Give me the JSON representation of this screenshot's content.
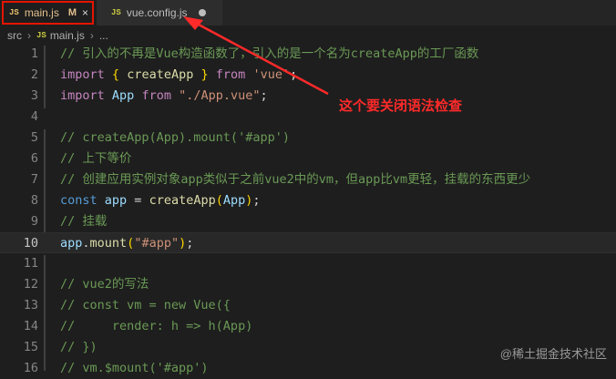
{
  "tabs": [
    {
      "icon": "JS",
      "label": "main.js",
      "status": "M",
      "close": "×"
    },
    {
      "icon": "JS",
      "label": "vue.config.js"
    }
  ],
  "breadcrumb": {
    "folder": "src",
    "file": "main.js",
    "ellipsis": "..."
  },
  "current_line": 10,
  "code": [
    {
      "num": "1",
      "tokens": [
        [
          "cm",
          "// 引入的不再是Vue构造函数了，引入的是一个名为createApp的工厂函数"
        ]
      ]
    },
    {
      "num": "2",
      "tokens": [
        [
          "kw2",
          "import"
        ],
        [
          "pu",
          " "
        ],
        [
          "br",
          "{"
        ],
        [
          "pu",
          " "
        ],
        [
          "fn",
          "createApp"
        ],
        [
          "pu",
          " "
        ],
        [
          "br",
          "}"
        ],
        [
          "pu",
          " "
        ],
        [
          "kw2",
          "from"
        ],
        [
          "pu",
          " "
        ],
        [
          "st",
          "'vue'"
        ],
        [
          "pu",
          ";"
        ]
      ]
    },
    {
      "num": "3",
      "tokens": [
        [
          "kw2",
          "import"
        ],
        [
          "pu",
          " "
        ],
        [
          "id",
          "App"
        ],
        [
          "pu",
          " "
        ],
        [
          "kw2",
          "from"
        ],
        [
          "pu",
          " "
        ],
        [
          "st",
          "\"./App.vue\""
        ],
        [
          "pu",
          ";"
        ]
      ]
    },
    {
      "num": "4",
      "tokens": []
    },
    {
      "num": "5",
      "tokens": [
        [
          "cm",
          "// createApp(App).mount('#app')"
        ]
      ]
    },
    {
      "num": "6",
      "tokens": [
        [
          "cm",
          "// 上下等价"
        ]
      ]
    },
    {
      "num": "7",
      "tokens": [
        [
          "cm",
          "// 创建应用实例对象app类似于之前vue2中的vm，但app比vm更轻，挂载的东西更少"
        ]
      ]
    },
    {
      "num": "8",
      "tokens": [
        [
          "kw",
          "const"
        ],
        [
          "pu",
          " "
        ],
        [
          "id",
          "app"
        ],
        [
          "pu",
          " = "
        ],
        [
          "fn",
          "createApp"
        ],
        [
          "br",
          "("
        ],
        [
          "id",
          "App"
        ],
        [
          "br",
          ")"
        ],
        [
          "pu",
          ";"
        ]
      ]
    },
    {
      "num": "9",
      "tokens": [
        [
          "cm",
          "// 挂载"
        ]
      ]
    },
    {
      "num": "10",
      "tokens": [
        [
          "id",
          "app"
        ],
        [
          "pu",
          "."
        ],
        [
          "fn",
          "mount"
        ],
        [
          "br",
          "("
        ],
        [
          "st",
          "\"#app\""
        ],
        [
          "br",
          ")"
        ],
        [
          "pu",
          ";"
        ]
      ]
    },
    {
      "num": "11",
      "tokens": []
    },
    {
      "num": "12",
      "tokens": [
        [
          "cm",
          "// vue2的写法"
        ]
      ]
    },
    {
      "num": "13",
      "tokens": [
        [
          "cm",
          "// const vm = new Vue({"
        ]
      ]
    },
    {
      "num": "14",
      "tokens": [
        [
          "cm",
          "//     render: h => h(App)"
        ]
      ]
    },
    {
      "num": "15",
      "tokens": [
        [
          "cm",
          "// })"
        ]
      ]
    },
    {
      "num": "16",
      "tokens": [
        [
          "cm",
          "// vm.$mount('#app')"
        ]
      ]
    }
  ],
  "annotation": "这个要关闭语法检查",
  "watermark": "@稀土掘金技术社区",
  "colors": {
    "highlight": "#e51400",
    "annotation": "#ff2a2a"
  }
}
